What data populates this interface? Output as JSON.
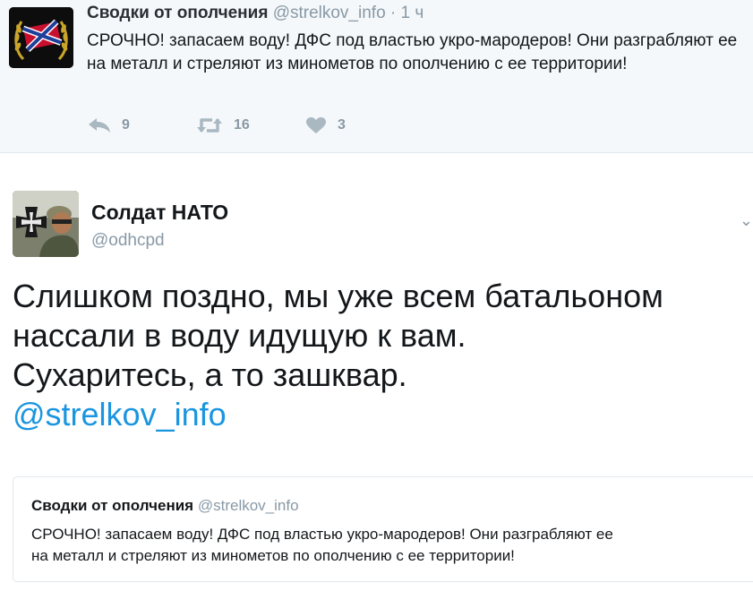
{
  "tweet1": {
    "name": "Сводки от ополчения",
    "handle": "@strelkov_info",
    "time": "· 1 ч",
    "text": "СРОЧНО! запасаем воду! ДФС под властью укро-мародеров! Они разграбляют ее на металл и стреляют из минометов по ополчению с ее территории!",
    "reply_count": "9",
    "retweet_count": "16",
    "like_count": "3"
  },
  "tweet2": {
    "name": "Солдат НАТО",
    "handle": "@odhcpd",
    "text_lines": [
      "Слишком поздно, мы уже всем батальоном",
      "нассали в воду идущую к вам.",
      "Сухаритесь, а то зашквар."
    ],
    "mention": "@strelkov_info"
  },
  "quote": {
    "name": "Сводки от ополчения",
    "handle": "@strelkov_info",
    "text_lines": [
      "СРОЧНО! запасаем воду! ДФС под властью укро-мародеров! Они разграбляют ее",
      "на металл и стреляют из минометов по ополчению с ее территории!"
    ]
  },
  "colors": {
    "name": "#14171a",
    "secondary": "#8899a6",
    "link": "#1b95e0",
    "top_bg": "#f5f8fa"
  },
  "icons": [
    "reply-icon",
    "retweet-icon",
    "heart-icon",
    "chevron-down-icon"
  ]
}
